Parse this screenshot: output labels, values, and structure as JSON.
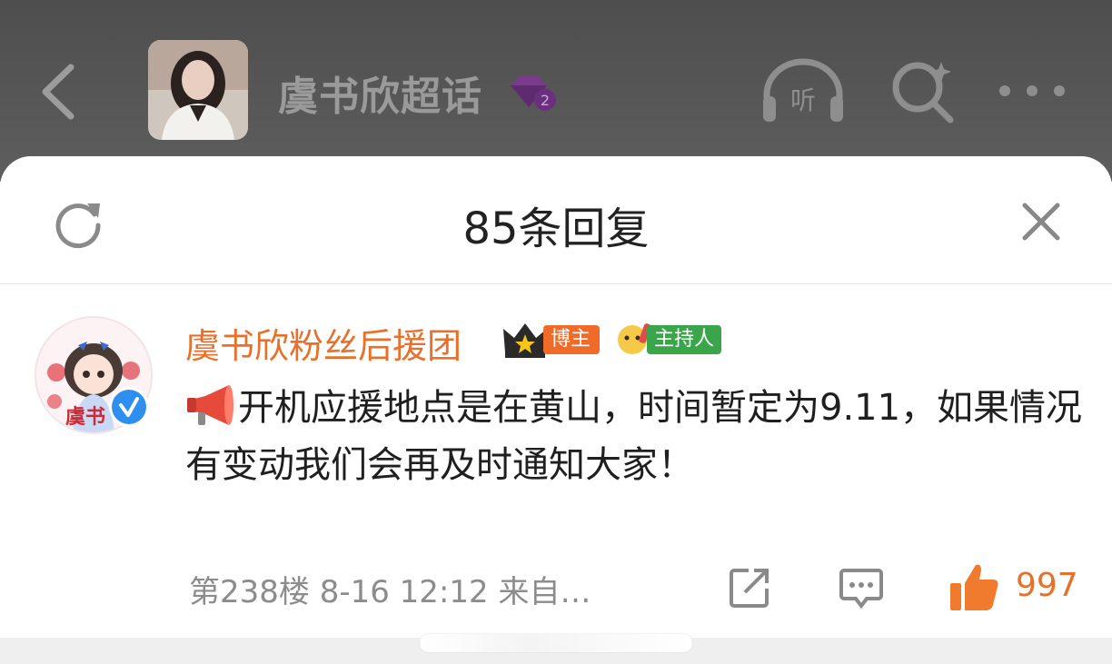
{
  "header": {
    "topic_title": "虞书欣超话",
    "badge_level": "2",
    "listen_label": "听"
  },
  "sheet": {
    "title": "85条回复"
  },
  "comment": {
    "username": "虞书欣粉丝后援团",
    "tags": [
      "博主",
      "主持人"
    ],
    "text": "开机应援地点是在黄山，时间暂定为9.11，如果情况有变动我们会再及时通知大家！",
    "meta": "第238楼 8-16 12:12 来自…",
    "like_count": "997",
    "avatar_caption": "虞书"
  },
  "colors": {
    "accent": "#e8702a",
    "blogger_tag": "#f06a2a",
    "host_tag": "#3aa54a",
    "verified": "#2f8ff0"
  }
}
